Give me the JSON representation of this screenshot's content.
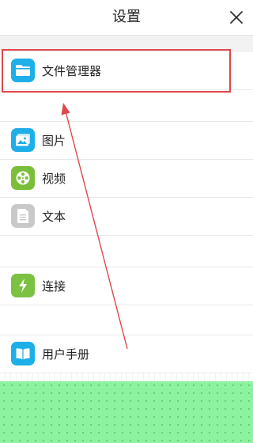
{
  "header": {
    "title": "设置"
  },
  "items": [
    {
      "label": "文件管理器",
      "icon": "folder-icon",
      "color": "#1eaee8"
    },
    {
      "label": "图片",
      "icon": "image-icon",
      "color": "#1eaee8"
    },
    {
      "label": "视频",
      "icon": "film-reel-icon",
      "color": "#7bbe3a"
    },
    {
      "label": "文本",
      "icon": "document-icon",
      "color": "#c9c9c9"
    },
    {
      "label": "连接",
      "icon": "lightning-icon",
      "color": "#7bc142"
    },
    {
      "label": "用户手册",
      "icon": "book-icon",
      "color": "#1eaee8"
    }
  ],
  "annotation": {
    "color": "#e0474c"
  }
}
